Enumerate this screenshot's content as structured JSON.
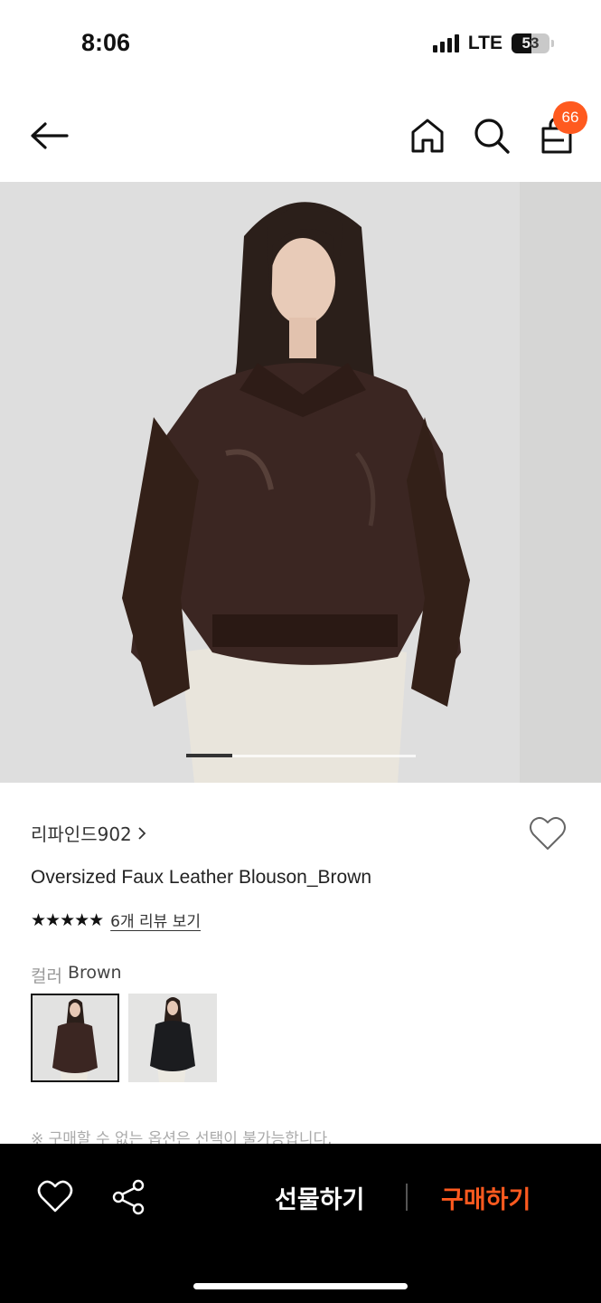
{
  "status_bar": {
    "time": "8:06",
    "network": "LTE",
    "battery": "53",
    "battery_level": 0.53
  },
  "header": {
    "cart_count": "66",
    "icons": [
      "back-arrow-icon",
      "home-icon",
      "search-icon",
      "shopping-bag-icon"
    ]
  },
  "product": {
    "brand": "리파인드902",
    "title": "Oversized Faux Leather Blouson_Brown",
    "rating_stars": "★★★★★",
    "rating": 5,
    "review_link": "6개 리뷰 보기",
    "color_key": "컬러",
    "color_value": "Brown",
    "swatches": [
      {
        "name": "Brown",
        "selected": true
      },
      {
        "name": "Black",
        "selected": false
      }
    ],
    "notice": "※ 구매할 수 없는 옵션은 선택이 불가능합니다."
  },
  "gallery": {
    "current_page": 1,
    "total_pages": 5
  },
  "bottom_bar": {
    "gift_label": "선물하기",
    "buy_label": "구매하기"
  },
  "colors": {
    "accent": "#ff5a1f",
    "bottom_bar_bg": "#000000"
  }
}
